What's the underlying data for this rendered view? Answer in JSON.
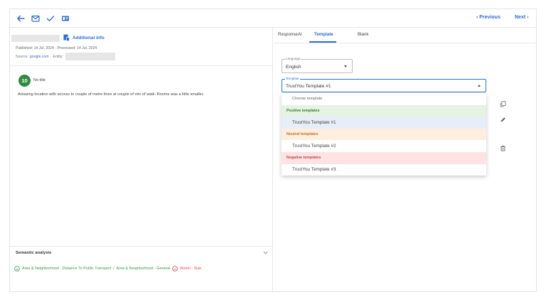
{
  "toolbar": {
    "icons": [
      "back-arrow-icon",
      "mail-icon",
      "check-icon",
      "card-icon"
    ],
    "previous_label": "‹  Previous",
    "next_label": "Next  ›"
  },
  "left": {
    "additional_info_label": "Additional info",
    "published": "Published: 14 Jul, 2024",
    "processed": "Processed: 14 Jul, 2024",
    "source_prefix": "Source:",
    "source_link": "google.com",
    "entity_label": "Entity:",
    "score": "10",
    "title": "No title",
    "review_text": "Amazing location with access to couple of metro lines at couple of min of walk. Rooms was a little smaller.",
    "semantic_title": "Semantic analysis",
    "semantic_positive": "Area & Neighborhood - Distance To Public Transport",
    "semantic_separator": "/",
    "semantic_positive_2": "Area & Neighborhood - General",
    "semantic_negative": "Room - Size",
    "colors": {
      "positive": "#3c9c4a",
      "negative": "#d94b4b",
      "score_bg": "#2e8b3e"
    }
  },
  "right": {
    "tabs": [
      {
        "label": "ResponseAI",
        "active": false
      },
      {
        "label": "Template",
        "active": true
      },
      {
        "label": "Blank",
        "active": false
      }
    ],
    "language": {
      "label": "Language",
      "value": "English"
    },
    "template": {
      "label": "Template",
      "value": "TrustYou Template #1"
    },
    "dropdown": {
      "placeholder": "Choose template",
      "groups": [
        {
          "name": "Positive templates",
          "kind": "positive",
          "items": [
            "TrustYou Template #1"
          ]
        },
        {
          "name": "Neutral templates",
          "kind": "neutral",
          "items": [
            "TrustYou Template #2"
          ]
        },
        {
          "name": "Negative templates",
          "kind": "negative",
          "items": [
            "TrustYou Template #3"
          ]
        }
      ],
      "selected": "TrustYou Template #1"
    },
    "accent_color": "#2a6fd6"
  }
}
